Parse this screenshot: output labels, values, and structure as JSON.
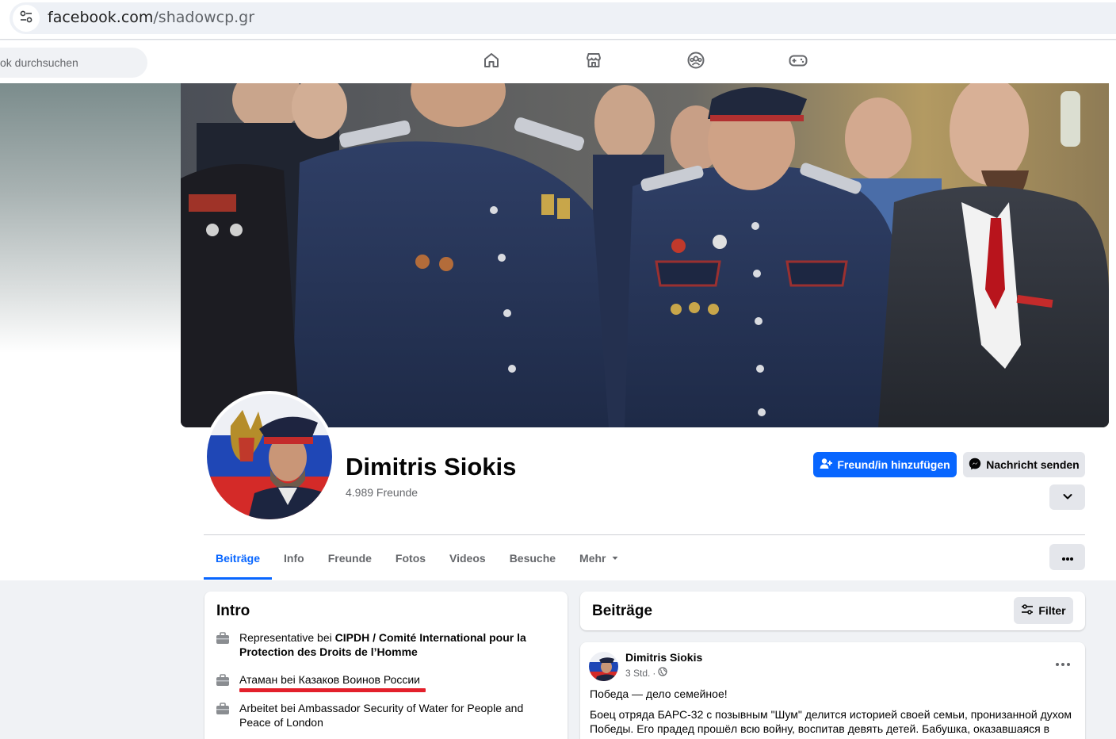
{
  "browser": {
    "url_domain": "facebook.com",
    "url_path": "/shadowcp.gr",
    "icons": [
      "tune-icon"
    ]
  },
  "nav": {
    "search_placeholder": "ok durchsuchen",
    "icons": [
      "home-icon",
      "marketplace-icon",
      "groups-icon",
      "gaming-icon"
    ]
  },
  "profile": {
    "name": "Dimitris Siokis",
    "friends": "4.989 Freunde",
    "add_friend_label": "Freund/in hinzufügen",
    "message_label": "Nachricht senden"
  },
  "tabs": [
    {
      "label": "Beiträge",
      "active": true
    },
    {
      "label": "Info"
    },
    {
      "label": "Freunde"
    },
    {
      "label": "Fotos"
    },
    {
      "label": "Videos"
    },
    {
      "label": "Besuche"
    },
    {
      "label": "Mehr"
    }
  ],
  "intro": {
    "title": "Intro",
    "items": [
      {
        "prefix": "Representative bei ",
        "bold": "CIPDH / Comité International pour la Protection des Droits de l’Homme"
      },
      {
        "text": "Атаман bei Казаков Воинов России",
        "highlighted": true
      },
      {
        "text": "Arbeitet bei Ambassador Security of Water for People and Peace of London"
      }
    ]
  },
  "posts": {
    "title": "Beiträge",
    "filter_label": "Filter",
    "items": [
      {
        "author": "Dimitris Siokis",
        "time": "3 Std.",
        "headline": "Победа — дело семейное!",
        "body": "Боец отряда БАРС-32 с позывным \"Шум\" делится историей своей семьи, пронизанной духом Победы. Его прадед прошёл всю войну, воспитав девять детей. Бабушка, оказавшаяся в"
      }
    ]
  },
  "colors": {
    "fb_blue": "#0866ff",
    "highlight_red": "#e3202b",
    "page_bg": "#f0f2f5"
  }
}
